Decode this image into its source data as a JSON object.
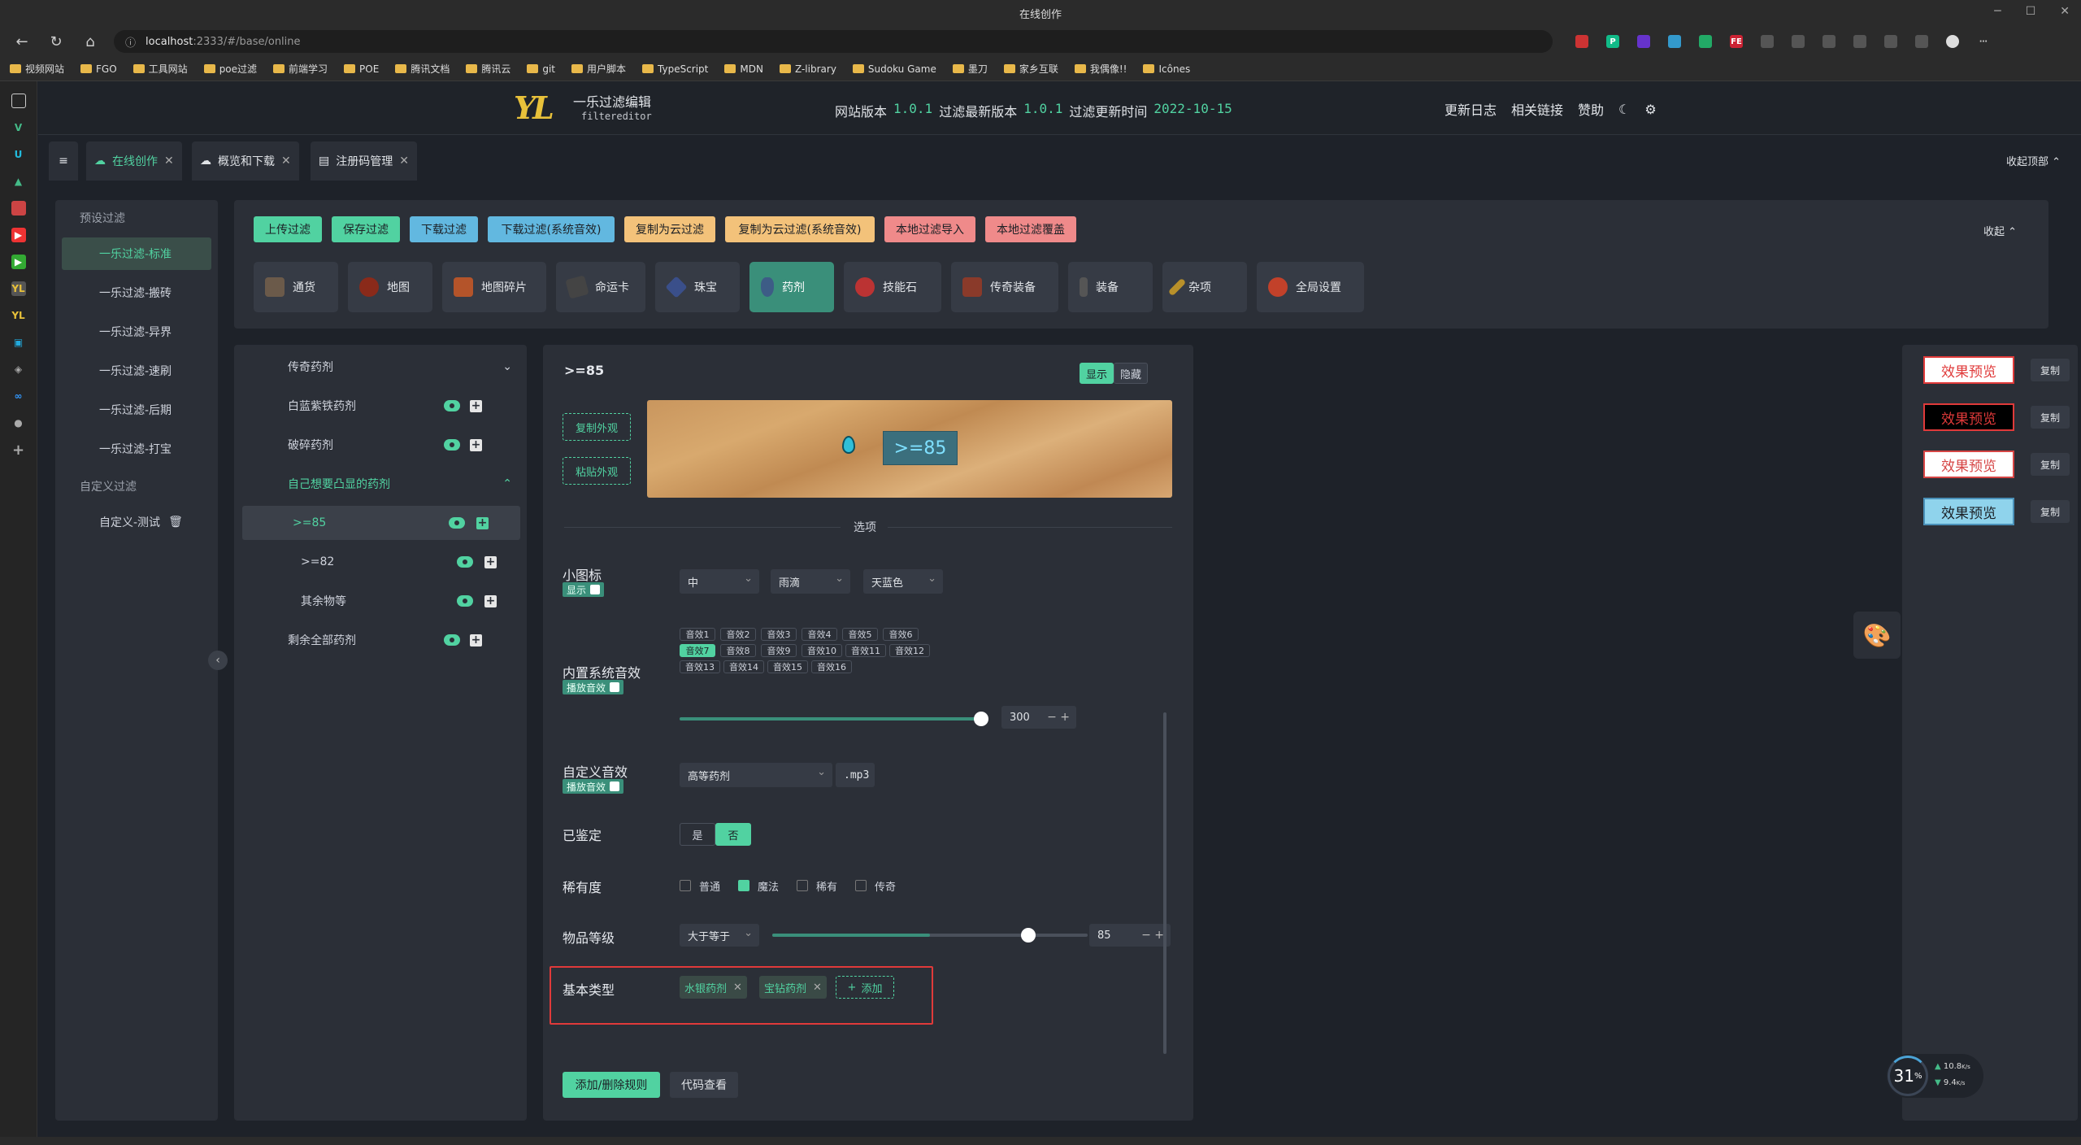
{
  "browser": {
    "title": "在线创作",
    "url_host": "localhost",
    "url_rest": ":2333/#/base/online"
  },
  "bookmarks": [
    "视频网站",
    "FGO",
    "工具网站",
    "poe过滤",
    "前端学习",
    "POE",
    "腾讯文档",
    "腾讯云",
    "git",
    "用户脚本",
    "TypeScript",
    "MDN",
    "Z-library",
    "Sudoku Game",
    "墨刀",
    "家乡互联",
    "我偶像!!",
    "Icônes"
  ],
  "header": {
    "logo": "YL",
    "title": "一乐过滤编辑",
    "subtitle": "filtereditor",
    "site_version_label": "网站版本",
    "site_version": "1.0.1",
    "filter_version_label": "过滤最新版本",
    "filter_version": "1.0.1",
    "update_time_label": "过滤更新时间",
    "update_time": "2022-10-15",
    "links": [
      "更新日志",
      "相关链接",
      "赞助"
    ]
  },
  "tabs": [
    {
      "label": "在线创作"
    },
    {
      "label": "概览和下载"
    },
    {
      "label": "注册码管理"
    }
  ],
  "collapse_top": "收起顶部",
  "sidebar": {
    "preset_title": "预设过滤",
    "items": [
      "一乐过滤-标准",
      "一乐过滤-搬砖",
      "一乐过滤-异界",
      "一乐过滤-速刷",
      "一乐过滤-后期",
      "一乐过滤-打宝"
    ],
    "custom_title": "自定义过滤",
    "custom_items": [
      "自定义-测试"
    ]
  },
  "toolbar": {
    "buttons": [
      "上传过滤",
      "保存过滤",
      "下载过滤",
      "下载过滤(系统音效)",
      "复制为云过滤",
      "复制为云过滤(系统音效)",
      "本地过滤导入",
      "本地过滤覆盖"
    ],
    "collapse": "收起",
    "categories": [
      "通货",
      "地图",
      "地图碎片",
      "命运卡",
      "珠宝",
      "药剂",
      "技能石",
      "传奇装备",
      "装备",
      "杂项",
      "全局设置"
    ]
  },
  "tree": [
    {
      "label": "传奇药剂"
    },
    {
      "label": "白蓝紫铁药剂"
    },
    {
      "label": "破碎药剂"
    },
    {
      "label": "自己想要凸显的药剂"
    },
    {
      "label": ">=85"
    },
    {
      "label": ">=82"
    },
    {
      "label": "其余物等"
    },
    {
      "label": "剩余全部药剂"
    }
  ],
  "editor": {
    "rule_title": ">=85",
    "show": "显示",
    "hide": "隐藏",
    "copy_look": "复制外观",
    "paste_look": "粘贴外观",
    "preview_text": ">=85",
    "options": "选项",
    "minimap_label": "小图标",
    "minimap_badge": "显示",
    "minimap_size": "中",
    "minimap_shape": "雨滴",
    "minimap_color": "天蓝色",
    "sound_label": "内置系统音效",
    "sound_badge": "播放音效",
    "sounds": [
      "音效1",
      "音效2",
      "音效3",
      "音效4",
      "音效5",
      "音效6",
      "音效7",
      "音效8",
      "音效9",
      "音效10",
      "音效11",
      "音效12",
      "音效13",
      "音效14",
      "音效15",
      "音效16"
    ],
    "sound_selected": "音效7",
    "volume": "300",
    "custom_sound_label": "自定义音效",
    "custom_sound_badge": "播放音效",
    "custom_sound_value": "高等药剂",
    "custom_sound_ext": ".mp3",
    "identified_label": "已鉴定",
    "yes": "是",
    "no": "否",
    "rarity_label": "稀有度",
    "rarities": [
      "普通",
      "魔法",
      "稀有",
      "传奇"
    ],
    "rarity_checked": "魔法",
    "level_label": "物品等级",
    "level_op": "大于等于",
    "level_value": "85",
    "base_label": "基本类型",
    "base_tags": [
      "水银药剂",
      "宝钻药剂"
    ],
    "add": "添加",
    "add_remove": "添加/删除规则",
    "view_code": "代码查看"
  },
  "right": {
    "preview": "效果预览",
    "copy": "复制"
  },
  "netmon": {
    "percent": "31",
    "unit": "%",
    "up": "10.8",
    "down": "9.4",
    "speed_unit": "K/s"
  }
}
